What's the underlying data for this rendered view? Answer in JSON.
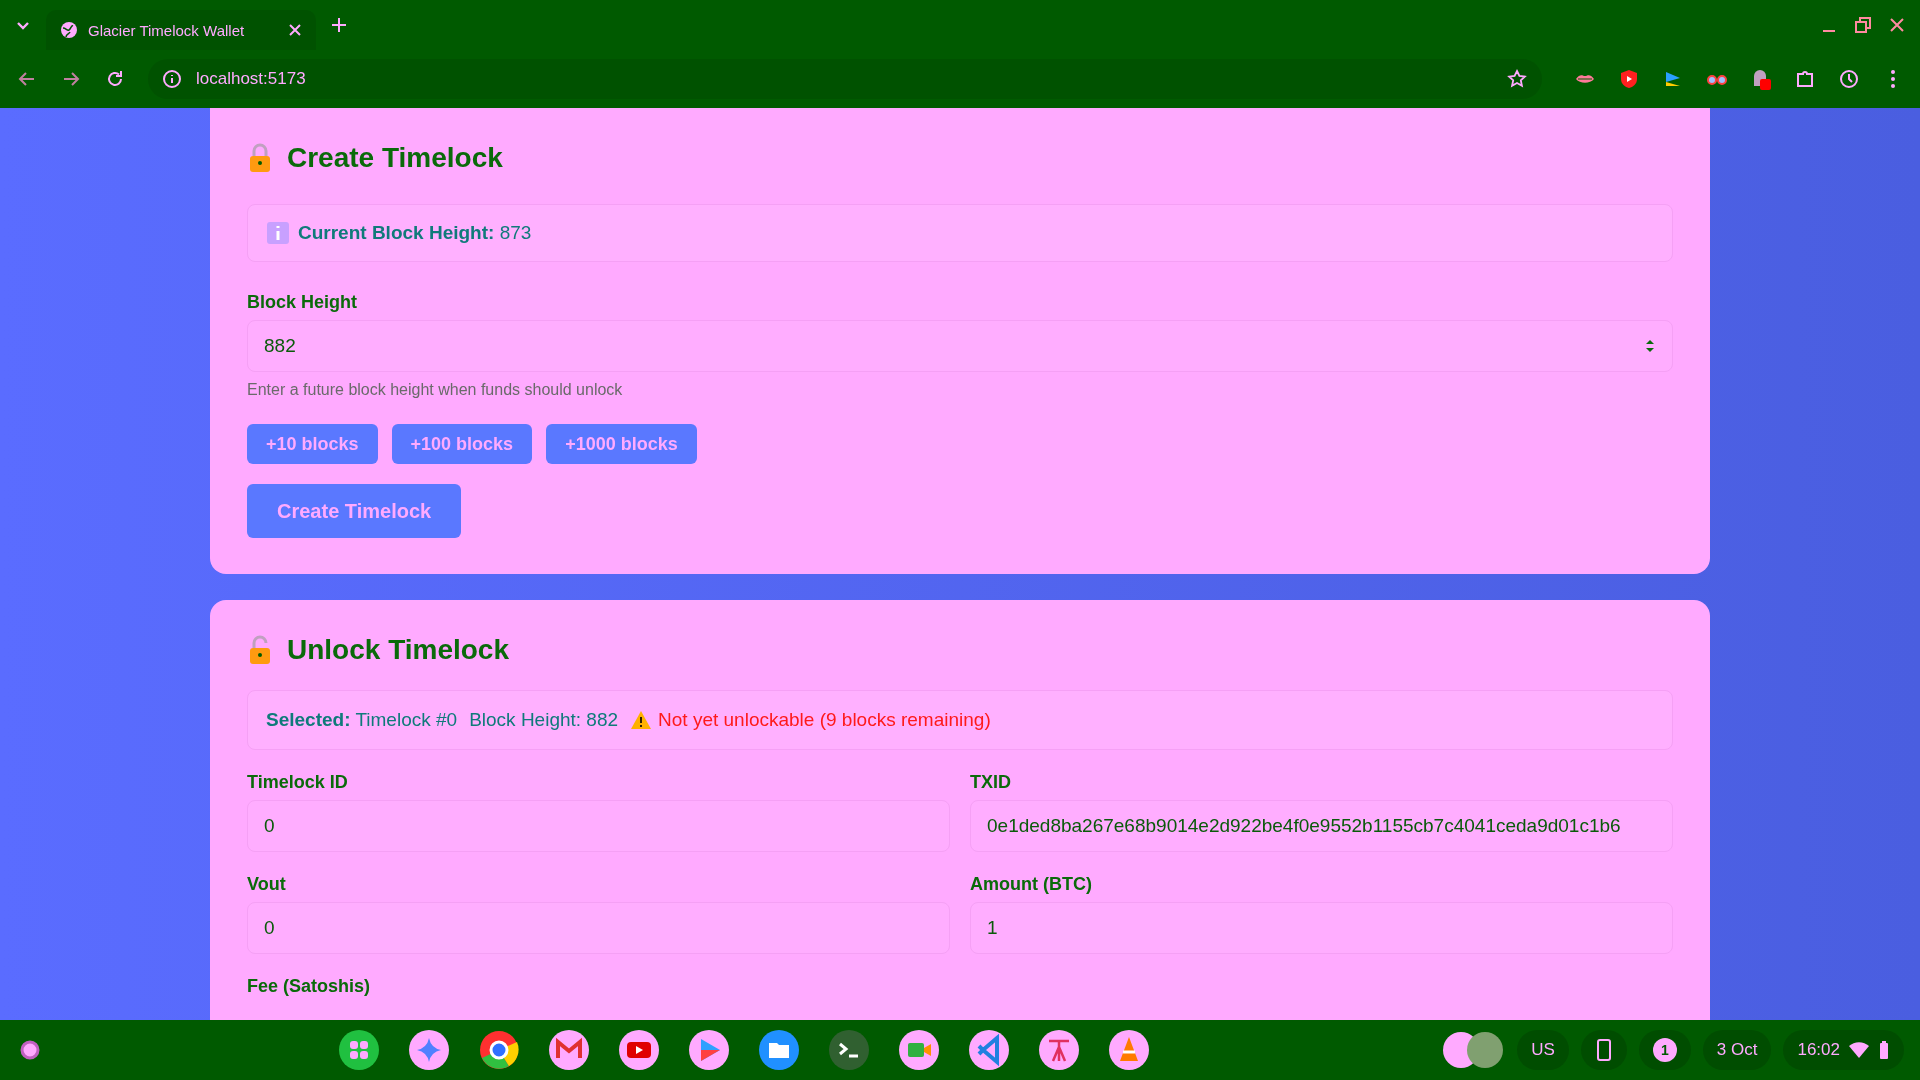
{
  "browser": {
    "tab_title": "Glacier Timelock Wallet",
    "url": "localhost:5173"
  },
  "create": {
    "title": "Create Timelock",
    "info_label": "Current Block Height:",
    "info_value": "873",
    "field_label": "Block Height",
    "field_value": "882",
    "hint": "Enter a future block height when funds should unlock",
    "quick_buttons": [
      "+10 blocks",
      "+100 blocks",
      "+1000 blocks"
    ],
    "submit": "Create Timelock"
  },
  "unlock": {
    "title": "Unlock Timelock",
    "selected_label": "Selected:",
    "selected_value": "Timelock #0",
    "block_height": "Block Height: 882",
    "warning": "Not yet unlockable (9 blocks remaining)",
    "fields": [
      {
        "label": "Timelock ID",
        "value": "0"
      },
      {
        "label": "TXID",
        "value": "0e1ded8ba267e68b9014e2d922be4f0e9552b1155cb7c4041ceda9d01c1b6"
      },
      {
        "label": "Vout",
        "value": "0"
      },
      {
        "label": "Amount (BTC)",
        "value": "1"
      }
    ],
    "next_label": "Fee (Satoshis)"
  },
  "taskbar": {
    "keyboard": "US",
    "notifications": "1",
    "date": "3 Oct",
    "time": "16:02"
  }
}
